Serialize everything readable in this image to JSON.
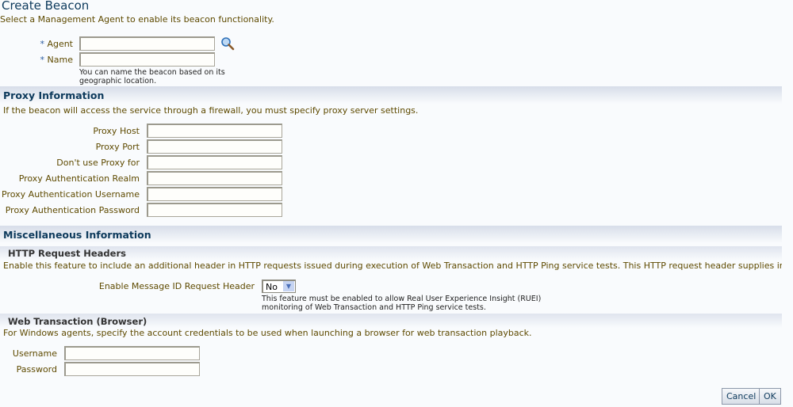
{
  "page": {
    "title": "Create Beacon",
    "subtitle": "Select a Management Agent to enable its beacon functionality."
  },
  "beacon": {
    "agent_label": "Agent",
    "name_label": "Name",
    "required_mark": "*",
    "agent_value": "",
    "name_value": "",
    "name_hint": "You can name the beacon based on its geographic location.",
    "search_icon": "magnifier-icon"
  },
  "proxy": {
    "title": "Proxy Information",
    "description": "If the beacon will access the service through a firewall, you must specify proxy server settings.",
    "fields": [
      {
        "label": "Proxy Host",
        "value": ""
      },
      {
        "label": "Proxy Port",
        "value": ""
      },
      {
        "label": "Don't use Proxy for",
        "value": ""
      },
      {
        "label": "Proxy Authentication Realm",
        "value": ""
      },
      {
        "label": "Proxy Authentication Username",
        "value": ""
      },
      {
        "label": "Proxy Authentication Password",
        "value": ""
      }
    ]
  },
  "misc": {
    "title": "Miscellaneous Information",
    "http": {
      "title": "HTTP Request Headers",
      "description": "Enable this feature to include an additional header in HTTP requests issued during execution of Web Transaction and HTTP Ping service tests. This HTTP request header supplies information to identify the te",
      "enable_label": "Enable Message ID Request Header",
      "enable_value": "No",
      "note": "This feature must be enabled to allow Real User Experience Insight (RUEI) monitoring of Web Transaction and HTTP Ping service tests."
    },
    "web": {
      "title": "Web Transaction (Browser)",
      "description": "For Windows agents, specify the account credentials to be used when launching a browser for web transaction playback.",
      "username_label": "Username",
      "username_value": "",
      "password_label": "Password",
      "password_value": ""
    }
  },
  "buttons": {
    "cancel": "Cancel",
    "ok": "OK"
  }
}
